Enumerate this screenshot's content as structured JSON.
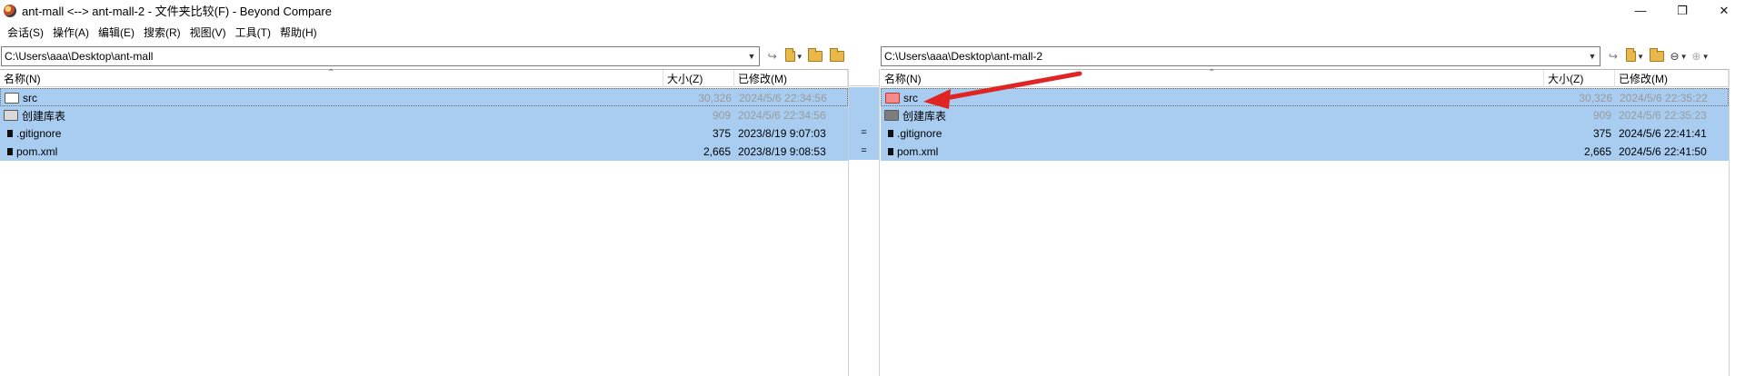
{
  "window": {
    "title": "ant-mall <--> ant-mall-2 - 文件夹比较(F) - Beyond Compare",
    "minimize_icon": "—",
    "restore_icon": "❐",
    "close_icon": "✕"
  },
  "menu": [
    "会话(S)",
    "操作(A)",
    "编辑(E)",
    "搜索(R)",
    "视图(V)",
    "工具(T)",
    "帮助(H)"
  ],
  "left": {
    "path": "C:\\Users\\aaa\\Desktop\\ant-mall",
    "columns": {
      "name": "名称(N)",
      "size": "大小(Z)",
      "modified": "已修改(M)"
    },
    "rows": [
      {
        "name": "src",
        "size": "30,326",
        "modified": "2024/5/6 22:34:56",
        "icon": "folder-empty-icon"
      },
      {
        "name": "创建库表",
        "size": "909",
        "modified": "2024/5/6 22:34:56",
        "icon": "folder-icon"
      },
      {
        "name": ".gitignore",
        "size": "375",
        "modified": "2023/8/19 9:07:03",
        "icon": "file-icon"
      },
      {
        "name": "pom.xml",
        "size": "2,665",
        "modified": "2023/8/19 9:08:53",
        "icon": "file-icon"
      }
    ]
  },
  "right": {
    "path": "C:\\Users\\aaa\\Desktop\\ant-mall-2",
    "columns": {
      "name": "名称(N)",
      "size": "大小(Z)",
      "modified": "已修改(M)"
    },
    "rows": [
      {
        "name": "src",
        "size": "30,326",
        "modified": "2024/5/6 22:35:22",
        "icon": "folder-red-icon"
      },
      {
        "name": "创建库表",
        "size": "909",
        "modified": "2024/5/6 22:35:23",
        "icon": "folder-dark-icon"
      },
      {
        "name": ".gitignore",
        "size": "375",
        "modified": "2024/5/6 22:41:41",
        "icon": "file-icon"
      },
      {
        "name": "pom.xml",
        "size": "2,665",
        "modified": "2024/5/6 22:41:50",
        "icon": "file-icon"
      }
    ]
  },
  "gutter": {
    "equal_marker": "="
  },
  "colors": {
    "row_selected": "#a8cdf0",
    "annotation_arrow": "#e02424",
    "folder_red": "#f28b8b"
  }
}
